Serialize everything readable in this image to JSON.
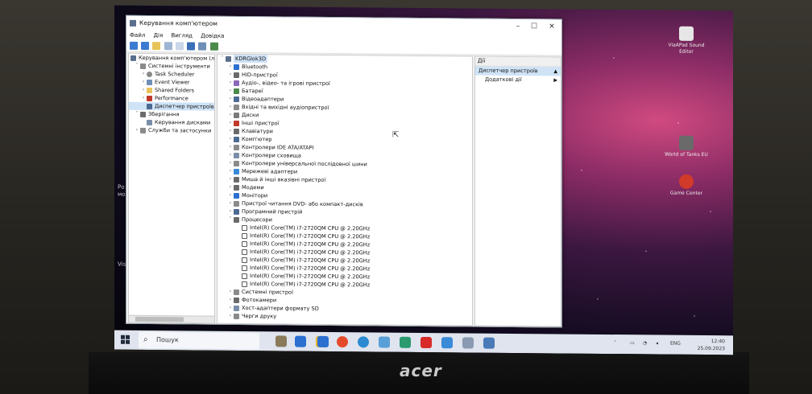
{
  "window": {
    "title": "Керування комп'ютером",
    "menu": [
      "Файл",
      "Дія",
      "Вигляд",
      "Довідка"
    ]
  },
  "left_tree": [
    {
      "label": "Керування комп'ютером (лок",
      "level": 0
    },
    {
      "label": "Системні інструменти",
      "level": 1
    },
    {
      "label": "Task Scheduler",
      "level": 2
    },
    {
      "label": "Event Viewer",
      "level": 2
    },
    {
      "label": "Shared Folders",
      "level": 2
    },
    {
      "label": "Performance",
      "level": 2
    },
    {
      "label": "Диспетчер пристроїв",
      "level": 2
    },
    {
      "label": "Зберігання",
      "level": 1
    },
    {
      "label": "Керування дисками",
      "level": 2
    },
    {
      "label": "Служби та застосунки",
      "level": 1
    }
  ],
  "device_tree": {
    "root": "KDRGlok3D",
    "categories_top": [
      "Bluetooth",
      "HID-пристрої",
      "Аудіо-, відео- та ігрові пристрої",
      "Батареї",
      "Відеоадаптери",
      "Вхідні та вихідні аудіопристрої",
      "Диски",
      "Інші пристрої",
      "Клавіатури",
      "Комп'ютер",
      "Контролери IDE ATA/ATAPI",
      "Контролери сховища",
      "Контролери універсальної послідовної шини",
      "Мережеві адаптери",
      "Миша й інші вказівні пристрої",
      "Модеми",
      "Монітори",
      "Пристрої читання DVD- або компакт-дисків",
      "Програмний пристрій"
    ],
    "processors_label": "Процесори",
    "processors": [
      "Intel(R) Core(TM) i7-2720QM CPU @ 2.20GHz",
      "Intel(R) Core(TM) i7-2720QM CPU @ 2.20GHz",
      "Intel(R) Core(TM) i7-2720QM CPU @ 2.20GHz",
      "Intel(R) Core(TM) i7-2720QM CPU @ 2.20GHz",
      "Intel(R) Core(TM) i7-2720QM CPU @ 2.20GHz",
      "Intel(R) Core(TM) i7-2720QM CPU @ 2.20GHz",
      "Intel(R) Core(TM) i7-2720QM CPU @ 2.20GHz",
      "Intel(R) Core(TM) i7-2720QM CPU @ 2.20GHz"
    ],
    "categories_bottom": [
      "Системні пристрої",
      "Фотокамери",
      "Хост-адаптери формату SD",
      "Черги друку"
    ]
  },
  "actions": {
    "header": "Дії",
    "items": [
      {
        "label": "Диспетчер пристроїв",
        "arrow": "▲"
      },
      {
        "label": "Додаткові дії",
        "arrow": "▶"
      }
    ]
  },
  "desktop": {
    "icons": [
      {
        "label": "ViaAPad Sound Editor",
        "color": "#e6e6e6"
      },
      {
        "label": "World of Tanks EU",
        "color": "#6a6a6a"
      },
      {
        "label": "Game Center",
        "color": "#d23a2a"
      }
    ],
    "left_fragments": [
      "Ро",
      "мо",
      "Vis"
    ]
  },
  "taskbar": {
    "search_placeholder": "Пошук",
    "tray_lang": "ENG",
    "time": "12:40",
    "date": "25.09.2023"
  },
  "brand": "acer",
  "colors": {
    "selection": "#cfe3f7",
    "folder": "#e8c35a",
    "device": "#4c6a92"
  }
}
